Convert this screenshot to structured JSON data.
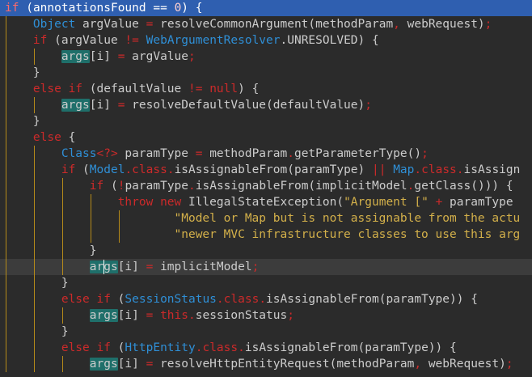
{
  "editor": {
    "lines": [
      {
        "hl": "top",
        "indent": 0,
        "tokens": [
          {
            "t": "kw",
            "v": "if"
          },
          {
            "t": "plain",
            "v": " ("
          },
          {
            "t": "plain",
            "v": "annotationsFound"
          },
          {
            "t": "plain",
            "v": " "
          },
          {
            "t": "punct",
            "v": "=="
          },
          {
            "t": "plain",
            "v": " "
          },
          {
            "t": "num",
            "v": "0"
          },
          {
            "t": "plain",
            "v": ") {"
          }
        ]
      },
      {
        "indent": 1,
        "tokens": [
          {
            "t": "type",
            "v": "Object"
          },
          {
            "t": "plain",
            "v": " argValue "
          },
          {
            "t": "punct",
            "v": "="
          },
          {
            "t": "plain",
            "v": " resolveCommonArgument(methodParam"
          },
          {
            "t": "punct",
            "v": ","
          },
          {
            "t": "plain",
            "v": " webRequest)"
          },
          {
            "t": "punct",
            "v": ";"
          }
        ]
      },
      {
        "indent": 1,
        "tokens": [
          {
            "t": "kw",
            "v": "if"
          },
          {
            "t": "plain",
            "v": " (argValue "
          },
          {
            "t": "punct",
            "v": "!="
          },
          {
            "t": "plain",
            "v": " "
          },
          {
            "t": "type",
            "v": "WebArgumentResolver"
          },
          {
            "t": "plain",
            "v": ".UNRESOLVED) {"
          }
        ]
      },
      {
        "indent": 2,
        "tokens": [
          {
            "t": "arg",
            "v": "args"
          },
          {
            "t": "plain",
            "v": "[i] "
          },
          {
            "t": "punct",
            "v": "="
          },
          {
            "t": "plain",
            "v": " argValue"
          },
          {
            "t": "punct",
            "v": ";"
          }
        ]
      },
      {
        "indent": 1,
        "tokens": [
          {
            "t": "plain",
            "v": "}"
          }
        ]
      },
      {
        "indent": 1,
        "tokens": [
          {
            "t": "kw",
            "v": "else if"
          },
          {
            "t": "plain",
            "v": " (defaultValue "
          },
          {
            "t": "punct",
            "v": "!="
          },
          {
            "t": "plain",
            "v": " "
          },
          {
            "t": "kw",
            "v": "null"
          },
          {
            "t": "plain",
            "v": ") {"
          }
        ]
      },
      {
        "indent": 2,
        "tokens": [
          {
            "t": "arg",
            "v": "args"
          },
          {
            "t": "plain",
            "v": "[i] "
          },
          {
            "t": "punct",
            "v": "="
          },
          {
            "t": "plain",
            "v": " resolveDefaultValue(defaultValue)"
          },
          {
            "t": "punct",
            "v": ";"
          }
        ]
      },
      {
        "indent": 1,
        "tokens": [
          {
            "t": "plain",
            "v": "}"
          }
        ]
      },
      {
        "indent": 1,
        "tokens": [
          {
            "t": "kw",
            "v": "else"
          },
          {
            "t": "plain",
            "v": " {"
          }
        ]
      },
      {
        "indent": 2,
        "tokens": [
          {
            "t": "type",
            "v": "Class"
          },
          {
            "t": "punct",
            "v": "<?>"
          },
          {
            "t": "plain",
            "v": " paramType "
          },
          {
            "t": "punct",
            "v": "="
          },
          {
            "t": "plain",
            "v": " methodParam"
          },
          {
            "t": "punct",
            "v": "."
          },
          {
            "t": "plain",
            "v": "getParameterType()"
          },
          {
            "t": "punct",
            "v": ";"
          }
        ]
      },
      {
        "indent": 2,
        "tokens": [
          {
            "t": "kw",
            "v": "if"
          },
          {
            "t": "plain",
            "v": " ("
          },
          {
            "t": "type",
            "v": "Model"
          },
          {
            "t": "punct",
            "v": "."
          },
          {
            "t": "kw",
            "v": "class"
          },
          {
            "t": "punct",
            "v": "."
          },
          {
            "t": "plain",
            "v": "isAssignableFrom(paramType) "
          },
          {
            "t": "punct",
            "v": "||"
          },
          {
            "t": "plain",
            "v": " "
          },
          {
            "t": "type",
            "v": "Map"
          },
          {
            "t": "punct",
            "v": "."
          },
          {
            "t": "kw",
            "v": "class"
          },
          {
            "t": "punct",
            "v": "."
          },
          {
            "t": "plain",
            "v": "isAssign"
          }
        ]
      },
      {
        "indent": 3,
        "tokens": [
          {
            "t": "kw",
            "v": "if"
          },
          {
            "t": "plain",
            "v": " ("
          },
          {
            "t": "punct",
            "v": "!"
          },
          {
            "t": "plain",
            "v": "paramType"
          },
          {
            "t": "punct",
            "v": "."
          },
          {
            "t": "plain",
            "v": "isAssignableFrom(implicitModel"
          },
          {
            "t": "punct",
            "v": "."
          },
          {
            "t": "plain",
            "v": "getClass())) {"
          }
        ]
      },
      {
        "indent": 4,
        "tokens": [
          {
            "t": "kw",
            "v": "throw new"
          },
          {
            "t": "plain",
            "v": " IllegalStateException("
          },
          {
            "t": "str",
            "v": "\"Argument [\""
          },
          {
            "t": "plain",
            "v": " "
          },
          {
            "t": "punct",
            "v": "+"
          },
          {
            "t": "plain",
            "v": " paramType"
          }
        ]
      },
      {
        "indent": 6,
        "tokens": [
          {
            "t": "str",
            "v": "\"Model or Map but is not assignable from the actu"
          }
        ]
      },
      {
        "indent": 6,
        "tokens": [
          {
            "t": "str",
            "v": "\"newer MVC infrastructure classes to use this arg"
          }
        ]
      },
      {
        "indent": 3,
        "tokens": [
          {
            "t": "plain",
            "v": "}"
          }
        ]
      },
      {
        "hl": "cur",
        "indent": 3,
        "tokens": [
          {
            "t": "arg",
            "v": "args"
          },
          {
            "t": "plain",
            "v": "[i] "
          },
          {
            "t": "punct",
            "v": "="
          },
          {
            "t": "plain",
            "v": " implicitModel"
          },
          {
            "t": "punct",
            "v": ";"
          }
        ]
      },
      {
        "indent": 2,
        "tokens": [
          {
            "t": "plain",
            "v": "}"
          }
        ]
      },
      {
        "indent": 2,
        "tokens": [
          {
            "t": "kw",
            "v": "else if"
          },
          {
            "t": "plain",
            "v": " ("
          },
          {
            "t": "type",
            "v": "SessionStatus"
          },
          {
            "t": "punct",
            "v": "."
          },
          {
            "t": "kw",
            "v": "class"
          },
          {
            "t": "punct",
            "v": "."
          },
          {
            "t": "plain",
            "v": "isAssignableFrom(paramType)) {"
          }
        ]
      },
      {
        "indent": 3,
        "tokens": [
          {
            "t": "arg",
            "v": "args"
          },
          {
            "t": "plain",
            "v": "[i] "
          },
          {
            "t": "punct",
            "v": "="
          },
          {
            "t": "plain",
            "v": " "
          },
          {
            "t": "kw",
            "v": "this"
          },
          {
            "t": "punct",
            "v": "."
          },
          {
            "t": "plain",
            "v": "sessionStatus"
          },
          {
            "t": "punct",
            "v": ";"
          }
        ]
      },
      {
        "indent": 2,
        "tokens": [
          {
            "t": "plain",
            "v": "}"
          }
        ]
      },
      {
        "indent": 2,
        "tokens": [
          {
            "t": "kw",
            "v": "else if"
          },
          {
            "t": "plain",
            "v": " ("
          },
          {
            "t": "type",
            "v": "HttpEntity"
          },
          {
            "t": "punct",
            "v": "."
          },
          {
            "t": "kw",
            "v": "class"
          },
          {
            "t": "punct",
            "v": "."
          },
          {
            "t": "plain",
            "v": "isAssignableFrom(paramType)) {"
          }
        ]
      },
      {
        "indent": 3,
        "tokens": [
          {
            "t": "arg",
            "v": "args"
          },
          {
            "t": "plain",
            "v": "[i] "
          },
          {
            "t": "punct",
            "v": "="
          },
          {
            "t": "plain",
            "v": " resolveHttpEntityRequest(methodParam"
          },
          {
            "t": "punct",
            "v": ","
          },
          {
            "t": "plain",
            "v": " webRequest)"
          },
          {
            "t": "punct",
            "v": ";"
          }
        ]
      }
    ],
    "colors": {
      "background": "#2b2b2b",
      "keyword": "#cc2a2a",
      "type": "#2f8fd6",
      "string": "#d3b04a",
      "selection": "#2f5fb0",
      "current_line": "#3c3c3c",
      "match_highlight": "#1f6f6a"
    }
  }
}
